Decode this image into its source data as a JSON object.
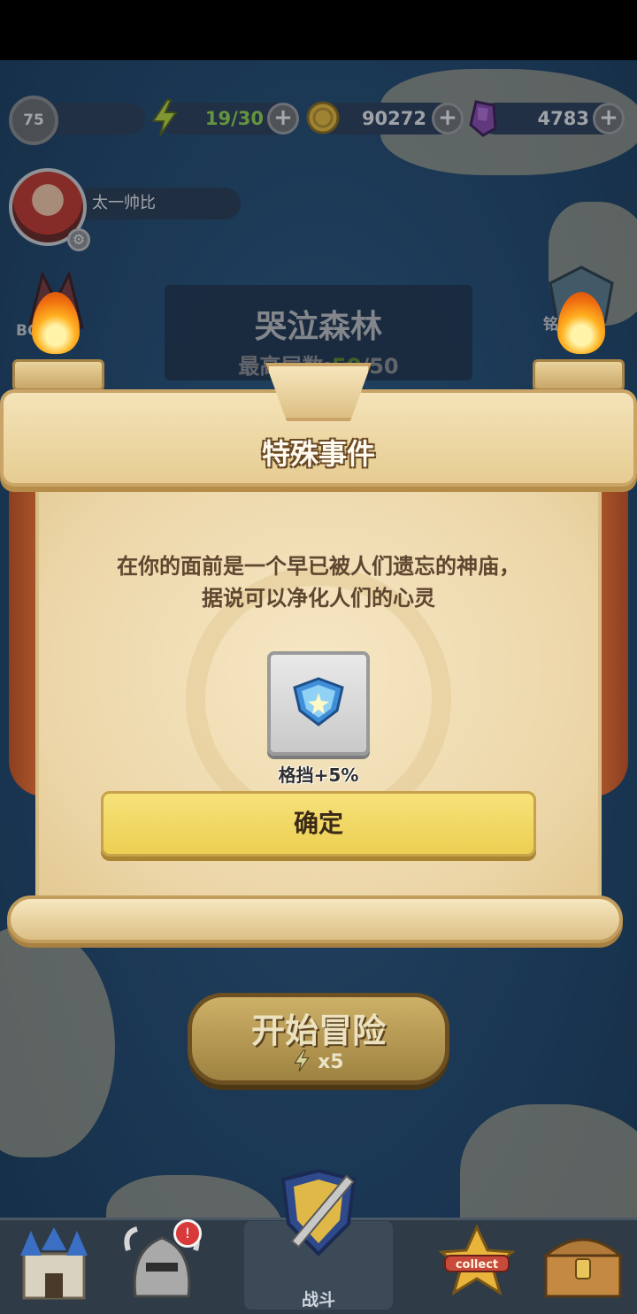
{
  "status_bar": {
    "level": "75",
    "energy": "19/30",
    "gold": "90272",
    "gems": "4783",
    "plus_symbol": "+",
    "energy_color": "#8fd14f"
  },
  "player": {
    "name": "太一帅比",
    "settings_icon": "gear-icon"
  },
  "stage": {
    "title": "哭泣森林",
    "max_floor_label": "最高层数:",
    "max_floor_current": "50",
    "max_floor_total": "/50"
  },
  "side_buttons": {
    "boss_label": "BOSS",
    "right_label": "铭刻"
  },
  "dialog": {
    "title": "特殊事件",
    "text_line1": "在你的面前是一个早已被人们遗忘的神庙，",
    "text_line2": "据说可以净化人们的心灵",
    "reward": {
      "icon": "shield-icon",
      "label": "格挡+5%"
    },
    "confirm_label": "确定"
  },
  "start_button": {
    "label": "开始冒险",
    "cost": "x5"
  },
  "bottom_nav": {
    "items": [
      {
        "icon": "castle-icon"
      },
      {
        "icon": "helmet-icon",
        "notify": "!"
      },
      {
        "icon": "sword-shield-icon",
        "label": "战斗"
      },
      {
        "icon": "collect-badge-icon",
        "text": "collect"
      },
      {
        "icon": "treasure-chest-icon"
      }
    ]
  }
}
